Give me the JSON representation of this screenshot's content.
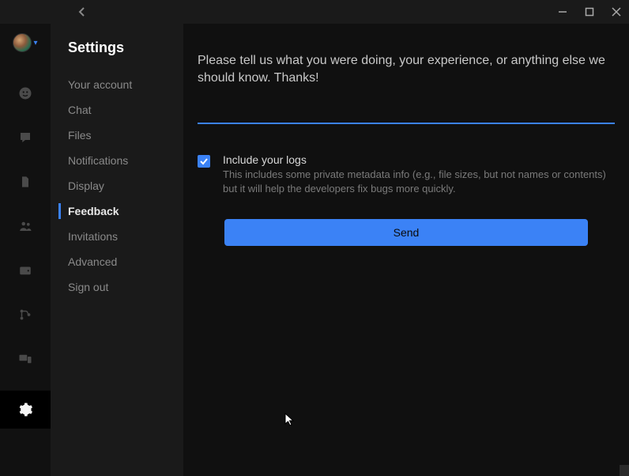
{
  "window": {
    "title": "Settings"
  },
  "nav": {
    "items": [
      {
        "label": "Your account"
      },
      {
        "label": "Chat"
      },
      {
        "label": "Files"
      },
      {
        "label": "Notifications"
      },
      {
        "label": "Display"
      },
      {
        "label": "Feedback"
      },
      {
        "label": "Invitations"
      },
      {
        "label": "Advanced"
      },
      {
        "label": "Sign out"
      }
    ],
    "selected": "Feedback"
  },
  "feedback": {
    "placeholder": "Please tell us what you were doing, your experience, or anything else we should know. Thanks!",
    "include_logs_label": "Include your logs",
    "include_logs_desc": "This includes some private metadata info (e.g., file sizes, but not names or contents) but it will help the developers fix bugs more quickly.",
    "include_logs_checked": true,
    "send_label": "Send"
  },
  "rail": {
    "icons": [
      "people-icon",
      "chat-icon",
      "folder-icon",
      "team-icon",
      "wallet-icon",
      "git-icon",
      "devices-icon",
      "settings-icon"
    ]
  },
  "colors": {
    "accent": "#3b82f6",
    "bg": "#101010",
    "panel": "#1a1a1a"
  }
}
